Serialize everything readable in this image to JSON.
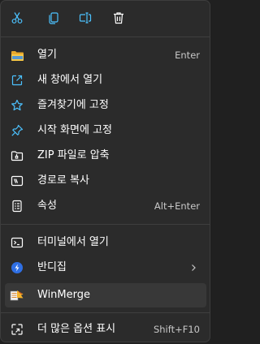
{
  "colors": {
    "accent": "#4cc2ff",
    "menu_bg": "#2b2b2b",
    "hover_bg": "#383838",
    "text": "#ffffff",
    "shortcut_text": "#c8c8c8"
  },
  "toolbar": {
    "icons": [
      "cut-icon",
      "copy-icon",
      "rename-icon",
      "delete-icon"
    ]
  },
  "items": [
    {
      "label": "열기",
      "shortcut": "Enter",
      "icon": "folder-icon"
    },
    {
      "label": "새 창에서 열기",
      "shortcut": "",
      "icon": "open-new-window-icon"
    },
    {
      "label": "즐겨찾기에 고정",
      "shortcut": "",
      "icon": "star-icon"
    },
    {
      "label": "시작 화면에 고정",
      "shortcut": "",
      "icon": "pin-icon"
    },
    {
      "label": "ZIP 파일로 압축",
      "shortcut": "",
      "icon": "zip-folder-icon"
    },
    {
      "label": "경로로 복사",
      "shortcut": "",
      "icon": "copy-path-icon"
    },
    {
      "label": "속성",
      "shortcut": "Alt+Enter",
      "icon": "properties-icon"
    },
    {
      "label": "터미널에서 열기",
      "shortcut": "",
      "icon": "terminal-icon"
    },
    {
      "label": "반디집",
      "shortcut": "",
      "icon": "bandizip-icon"
    },
    {
      "label": "WinMerge",
      "shortcut": "",
      "icon": "winmerge-icon"
    },
    {
      "label": "더 많은 옵션 표시",
      "shortcut": "Shift+F10",
      "icon": "more-options-icon"
    }
  ]
}
